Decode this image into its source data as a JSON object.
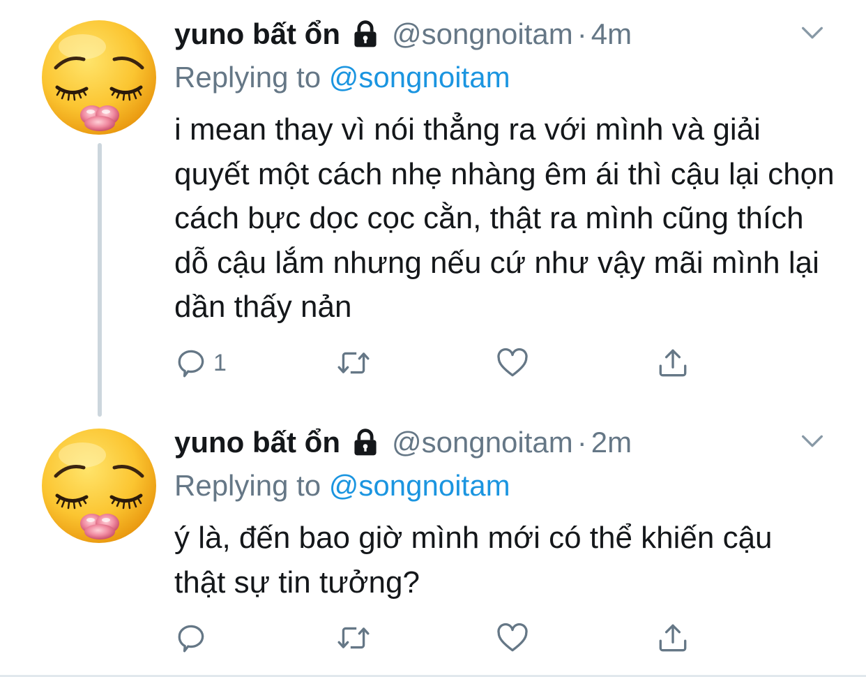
{
  "colors": {
    "text": "#14171a",
    "secondary": "#657786",
    "link": "#1b95e0",
    "thread_line": "#ccd6dd"
  },
  "tweets": [
    {
      "name": "yuno bất ổn",
      "handle": "@songnoitam",
      "separator": "·",
      "time": "4m",
      "replying_prefix": "Replying to",
      "replying_to": "@songnoitam",
      "text": "i mean thay vì nói thẳng ra với mình và giải quyết một cách nhẹ nhàng êm ái thì cậu lại chọn cách bực dọc cọc cằn, thật ra mình cũng thích dỗ cậu lắm nhưng nếu cứ như vậy mãi mình lại dần thấy nản",
      "reply_count": "1",
      "icons": [
        "pleading-emoji-avatar",
        "lock-icon",
        "chevron-down-icon",
        "reply-icon",
        "retweet-icon",
        "like-icon",
        "share-icon"
      ]
    },
    {
      "name": "yuno bất ổn",
      "handle": "@songnoitam",
      "separator": "·",
      "time": "2m",
      "replying_prefix": "Replying to",
      "replying_to": "@songnoitam",
      "text": "ý là, đến bao giờ mình mới có thể khiến cậu thật sự tin tưởng?",
      "reply_count": "",
      "icons": [
        "pleading-emoji-avatar",
        "lock-icon",
        "chevron-down-icon",
        "reply-icon",
        "retweet-icon",
        "like-icon",
        "share-icon"
      ]
    }
  ]
}
